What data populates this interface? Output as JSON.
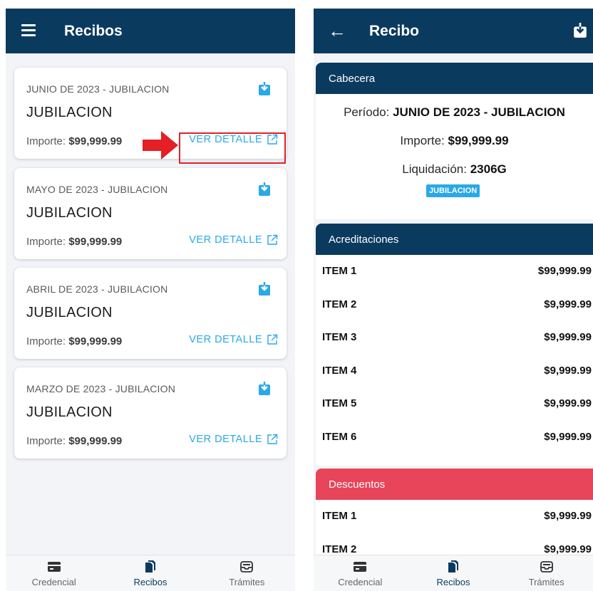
{
  "left_screen": {
    "appbar": {
      "title": "Recibos"
    },
    "receipts": [
      {
        "period": "JUNIO DE 2023 - JUBILACION",
        "name": "JUBILACION",
        "amount_label": "Importe:",
        "amount": "$99,999.99",
        "detail_label": "VER DETALLE"
      },
      {
        "period": "MAYO DE 2023 - JUBILACION",
        "name": "JUBILACION",
        "amount_label": "Importe:",
        "amount": "$99,999.99",
        "detail_label": "VER DETALLE"
      },
      {
        "period": "ABRIL DE 2023 - JUBILACION",
        "name": "JUBILACION",
        "amount_label": "Importe:",
        "amount": "$99,999.99",
        "detail_label": "VER DETALLE"
      },
      {
        "period": "MARZO DE 2023 - JUBILACION",
        "name": "JUBILACION",
        "amount_label": "Importe:",
        "amount": "$99,999.99",
        "detail_label": "VER DETALLE"
      }
    ]
  },
  "right_screen": {
    "appbar": {
      "title": "Recibo"
    },
    "cabecera": {
      "title": "Cabecera",
      "period_label": "Período:",
      "period_value": "JUNIO DE 2023 - JUBILACION",
      "amount_label": "Importe:",
      "amount_value": "$99,999.99",
      "liquidation_label": "Liquidación:",
      "liquidation_value": "2306G",
      "badge": "JUBILACION"
    },
    "acreditaciones": {
      "title": "Acreditaciones",
      "items": [
        {
          "label": "ITEM 1",
          "value": "$99,999.99"
        },
        {
          "label": "ITEM 2",
          "value": "$9,999.99"
        },
        {
          "label": "ITEM 3",
          "value": "$9,999.99"
        },
        {
          "label": "ITEM 4",
          "value": "$9,999.99"
        },
        {
          "label": "ITEM 5",
          "value": "$9,999.99"
        },
        {
          "label": "ITEM 6",
          "value": "$9,999.99"
        }
      ]
    },
    "descuentos": {
      "title": "Descuentos",
      "items": [
        {
          "label": "ITEM 1",
          "value": "$9,999.99"
        },
        {
          "label": "ITEM 2",
          "value": "$9,999.99"
        }
      ]
    }
  },
  "bottom_nav": {
    "items": [
      {
        "label": "Credencial",
        "icon": "card-icon"
      },
      {
        "label": "Recibos",
        "icon": "documents-icon"
      },
      {
        "label": "Trámites",
        "icon": "inbox-icon"
      }
    ]
  },
  "colors": {
    "appbar": "#0b3a5f",
    "accent": "#29a9e6",
    "discount": "#e8445a",
    "highlight": "#e41f26"
  }
}
